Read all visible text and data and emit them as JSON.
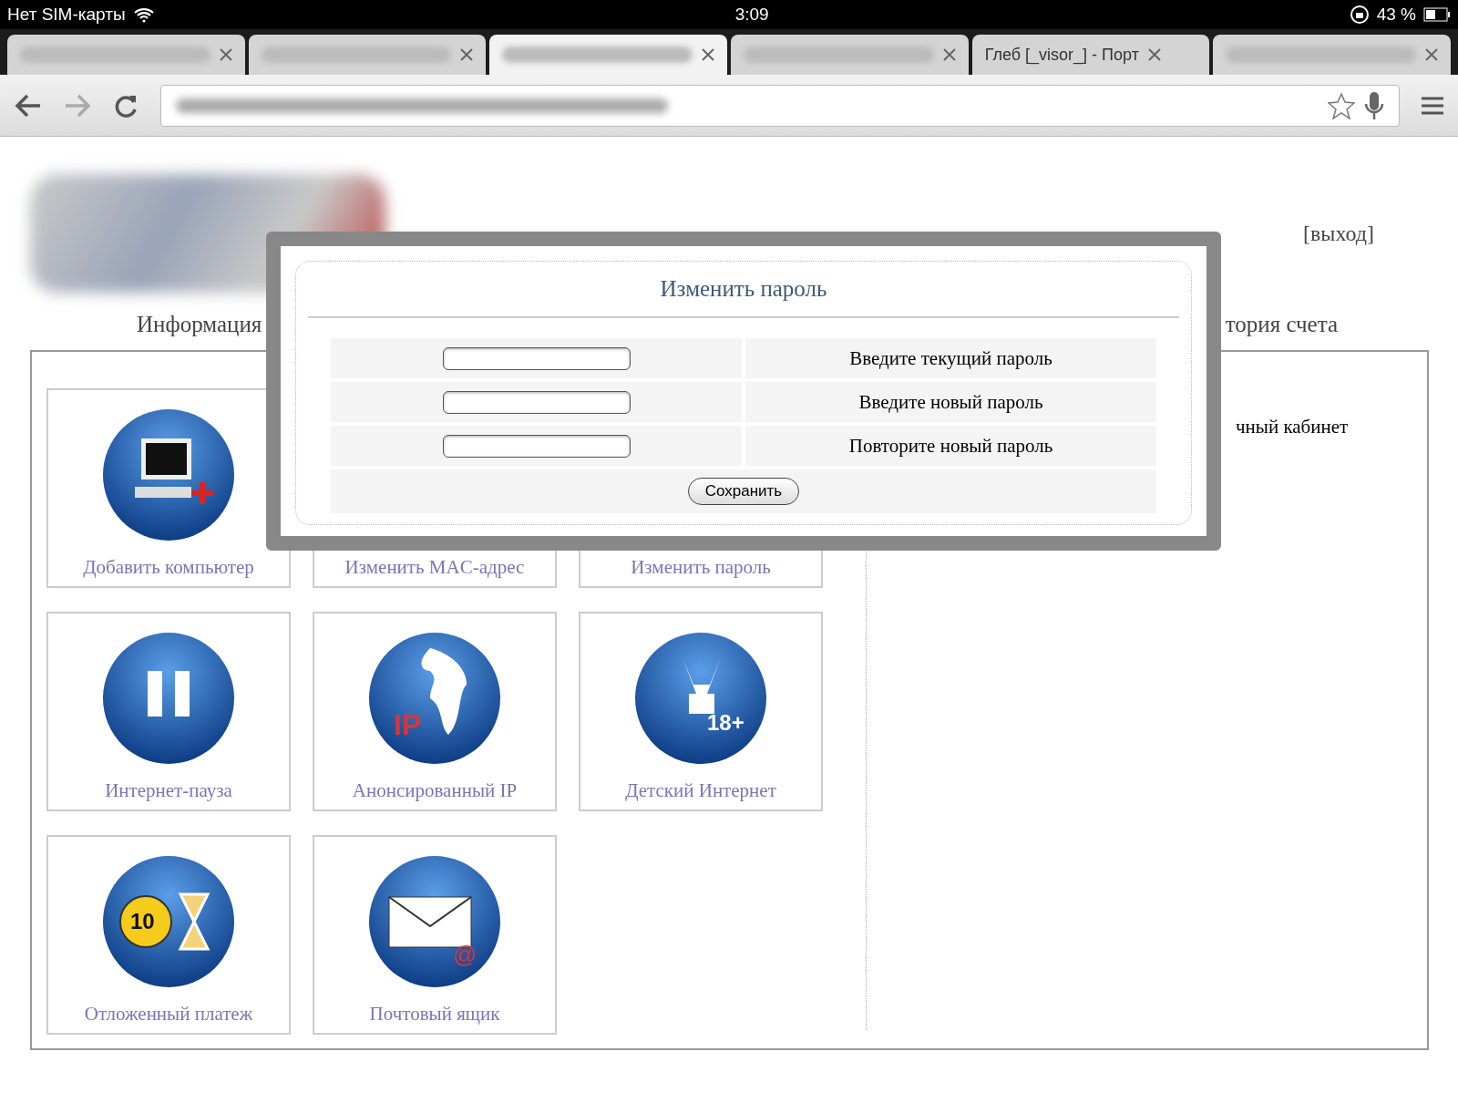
{
  "status_bar": {
    "carrier": "Нет SIM-карты",
    "time": "3:09",
    "battery": "43 %"
  },
  "tabs": [
    {
      "blurred": true,
      "selected": false
    },
    {
      "blurred": true,
      "selected": false
    },
    {
      "blurred": true,
      "selected": true
    },
    {
      "blurred": true,
      "selected": false
    },
    {
      "title": "Глеб [_visor_] - Порт",
      "blurred": false,
      "selected": false
    },
    {
      "blurred": true,
      "selected": false
    }
  ],
  "address_bar": {
    "blurred": true
  },
  "page": {
    "logout": "[выход]",
    "nav": [
      "Информация",
      "тория счета"
    ],
    "side_text": "чный кабинет",
    "tiles": [
      {
        "label": "Добавить компьютер",
        "kind": "computer"
      },
      {
        "label": "Изменить MAC-адрес"
      },
      {
        "label": "Изменить пароль"
      },
      {
        "label": "Интернет-пауза",
        "kind": "pause"
      },
      {
        "label": "Анонсированный IP",
        "kind": "globe",
        "icon_text": "IP"
      },
      {
        "label": "Детский Интернет",
        "kind": "bunny",
        "icon_text": "18+"
      },
      {
        "label": "Отложенный платеж",
        "kind": "coin",
        "icon_text": "10"
      },
      {
        "label": "Почтовый ящик",
        "kind": "mail",
        "icon_text": "@"
      }
    ]
  },
  "modal": {
    "title": "Изменить пароль",
    "fields": [
      {
        "label": "Введите текущий пароль"
      },
      {
        "label": "Введите новый пароль"
      },
      {
        "label": "Повторите новый пароль"
      }
    ],
    "button": "Сохранить"
  }
}
